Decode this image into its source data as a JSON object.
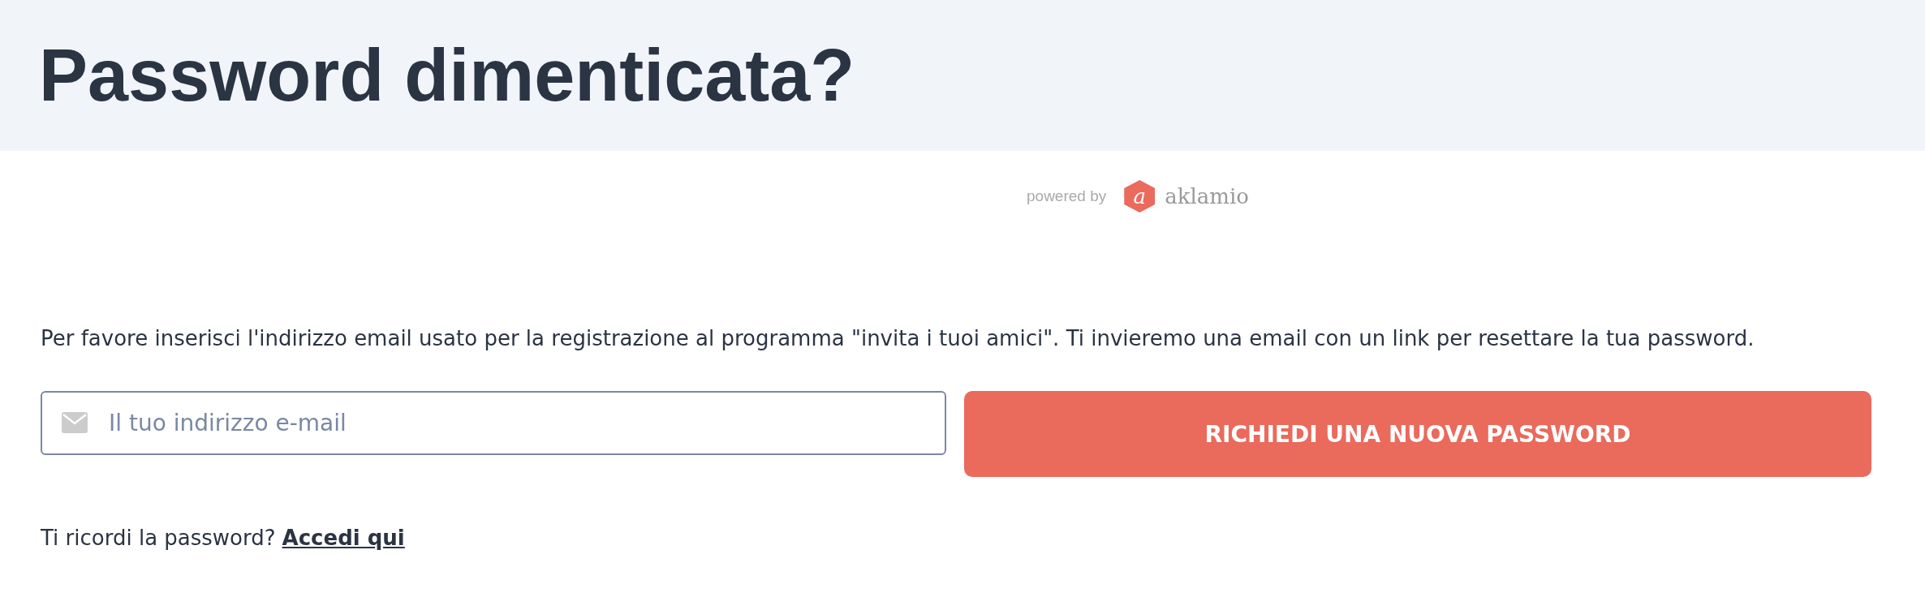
{
  "header": {
    "title": "Password dimenticata?"
  },
  "branding": {
    "prefix": "powered by",
    "logo_mark": "a",
    "name": "aklamio"
  },
  "instructions": "Per favore inserisci l'indirizzo email usato per la registrazione al programma \"invita i tuoi amici\". Ti invieremo una email con un link per resettare la tua password.",
  "email_field": {
    "placeholder": "Il tuo indirizzo e-mail"
  },
  "submit_button": "RICHIEDI UNA NUOVA PASSWORD",
  "login_prompt": {
    "text": "Ti ricordi la password?",
    "link": "Accedi qui"
  }
}
